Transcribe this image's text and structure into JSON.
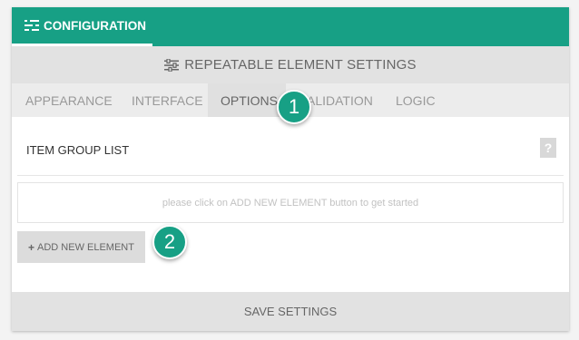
{
  "header": {
    "tab_label": "CONFIGURATION",
    "tab_icon": "settings-list-icon"
  },
  "settings": {
    "title": "REPEATABLE ELEMENT SETTINGS",
    "icon": "sliders-icon"
  },
  "tabs": [
    {
      "label": "APPEARANCE",
      "active": false
    },
    {
      "label": "INTERFACE",
      "active": false
    },
    {
      "label": "OPTIONS",
      "active": true
    },
    {
      "label": "ALIDATION",
      "active": false
    },
    {
      "label": "LOGIC",
      "active": false
    }
  ],
  "content": {
    "group_label": "ITEM GROUP LIST",
    "help_symbol": "?",
    "empty_message": "please click on ADD NEW ELEMENT button to get started",
    "add_button_label": "ADD NEW ELEMENT"
  },
  "callouts": [
    "1",
    "2"
  ],
  "footer": {
    "save_label": "SAVE SETTINGS"
  },
  "colors": {
    "accent": "#17a085",
    "header_gray": "#e2e2e2",
    "tab_gray": "#ececec"
  }
}
